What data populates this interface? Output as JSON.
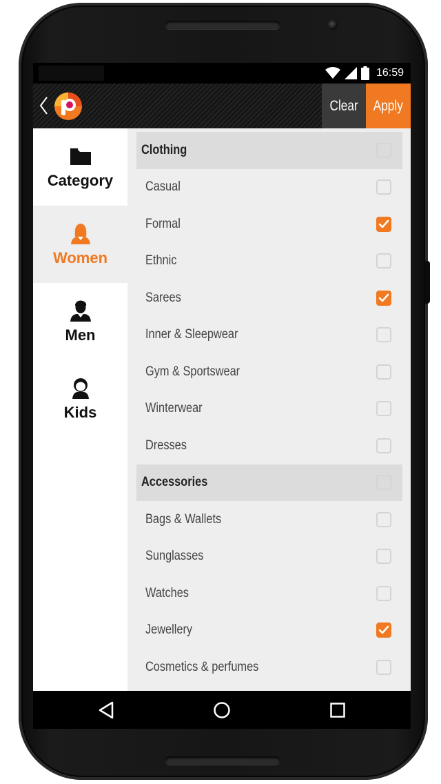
{
  "status_bar": {
    "time": "16:59",
    "icons": [
      "wifi-icon",
      "signal-icon",
      "battery-icon"
    ]
  },
  "toolbar": {
    "back_icon": "chevron-left-icon",
    "logo": "app-logo",
    "clear_label": "Clear",
    "apply_label": "Apply"
  },
  "colors": {
    "accent": "#f07921",
    "panel": "#eeeeee",
    "section_header": "#dcdcdc",
    "sidebar": "#ffffff"
  },
  "sidebar": {
    "items": [
      {
        "label": "Category",
        "icon": "folder-icon",
        "active": false
      },
      {
        "label": "Women",
        "icon": "woman-icon",
        "active": true
      },
      {
        "label": "Men",
        "icon": "man-icon",
        "active": false
      },
      {
        "label": "Kids",
        "icon": "kid-icon",
        "active": false
      }
    ]
  },
  "filters": {
    "rows": [
      {
        "label": "Clothing",
        "type": "section",
        "checked": false
      },
      {
        "label": "Casual",
        "type": "item",
        "checked": false
      },
      {
        "label": "Formal",
        "type": "item",
        "checked": true
      },
      {
        "label": "Ethnic",
        "type": "item",
        "checked": false
      },
      {
        "label": "Sarees",
        "type": "item",
        "checked": true
      },
      {
        "label": "Inner & Sleepwear",
        "type": "item",
        "checked": false
      },
      {
        "label": "Gym & Sportswear",
        "type": "item",
        "checked": false
      },
      {
        "label": "Winterwear",
        "type": "item",
        "checked": false
      },
      {
        "label": "Dresses",
        "type": "item",
        "checked": false
      },
      {
        "label": "Accessories",
        "type": "section",
        "checked": false
      },
      {
        "label": "Bags & Wallets",
        "type": "item",
        "checked": false
      },
      {
        "label": "Sunglasses",
        "type": "item",
        "checked": false
      },
      {
        "label": "Watches",
        "type": "item",
        "checked": false
      },
      {
        "label": "Jewellery",
        "type": "item",
        "checked": true
      },
      {
        "label": "Cosmetics & perfumes",
        "type": "item",
        "checked": false
      }
    ]
  },
  "nav_bar": {
    "buttons": [
      "back-triangle-icon",
      "home-circle-icon",
      "recents-square-icon"
    ]
  }
}
